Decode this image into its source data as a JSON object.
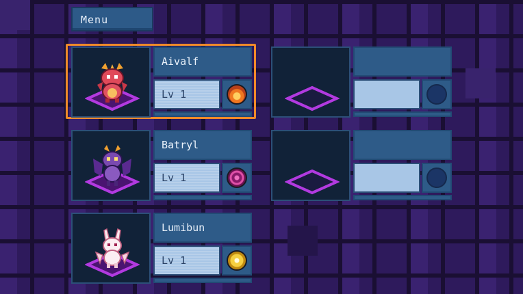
{
  "menu": {
    "label": "Menu"
  },
  "party": [
    {
      "name": "Aivalf",
      "level": "Lv 1",
      "element_icon": "fire-element-icon",
      "element_color": "#e05a1a",
      "selected": true
    },
    {
      "name": "Batryl",
      "level": "Lv 1",
      "element_icon": "dark-element-icon",
      "element_color": "#b0357a",
      "selected": false
    },
    {
      "name": "Lumibun",
      "level": "Lv 1",
      "element_icon": "light-element-icon",
      "element_color": "#e8c030",
      "selected": false
    }
  ],
  "empty_slots": [
    {
      "name": "",
      "level": ""
    },
    {
      "name": "",
      "level": ""
    }
  ],
  "colors": {
    "selection": "#f08a2a",
    "panel": "#2e5b88",
    "level_box": "#a8c6e6",
    "platform": "#9a2fc2"
  }
}
